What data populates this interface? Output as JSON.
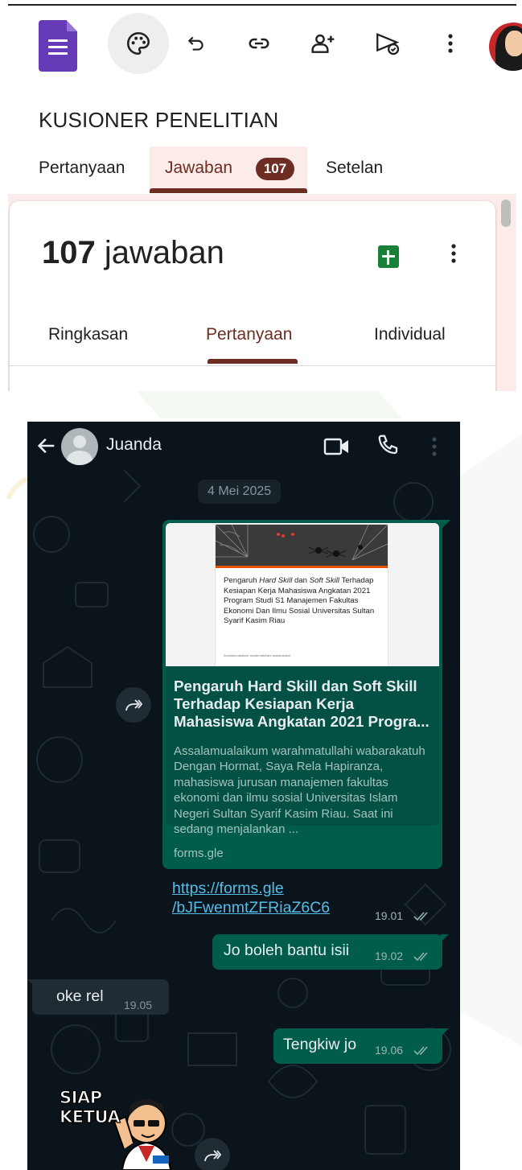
{
  "forms": {
    "toolbar": {
      "logo_icon": "google-forms-icon",
      "icons": [
        "palette-icon",
        "undo-icon",
        "link-icon",
        "add-collaborator-icon",
        "send-icon",
        "more-vert-icon"
      ]
    },
    "title": "KUSIONER PENELITIAN",
    "tabs": [
      {
        "label": "Pertanyaan",
        "active": false
      },
      {
        "label": "Jawaban",
        "active": true,
        "badge": "107"
      },
      {
        "label": "Setelan",
        "active": false
      }
    ],
    "responses": {
      "count": "107",
      "label": "jawaban",
      "sub_tabs": [
        {
          "label": "Ringkasan",
          "active": false
        },
        {
          "label": "Pertanyaan",
          "active": true
        },
        {
          "label": "Individual",
          "active": false
        }
      ]
    },
    "colors": {
      "accent": "#6d2d22",
      "forms_purple": "#673ab7",
      "sheets_green": "#188038"
    }
  },
  "whatsapp": {
    "contact_name": "Juanda",
    "date_chip": "4 Mei 2025",
    "link_preview": {
      "image_text_prefix": "Pengaruh ",
      "image_text_em1": "Hard Skill",
      "image_text_mid": " dan ",
      "image_text_em2": "Soft Skill",
      "image_text_rest": " Terhadap Kesiapan Kerja Mahasiswa Angkatan 2021 Program Studi S1 Manajemen Fakultas Ekonomi Dan Ilmu Sosial Universitas Sultan Syarif Kasim Riau",
      "image_tiny_line": "Assalamualaikum warahmatullahi wabarakatuh",
      "title": "Pengaruh Hard Skill dan Soft Skill Terhadap Kesiapan Kerja Mahasiswa Angkatan 2021 Progra...",
      "description": "Assalamualaikum warahmatullahi wabarakatuh Dengan Hormat, Saya Rela Hapiranza, mahasiswa jurusan manajemen fakultas ekonomi dan ilmu sosial Universitas Islam Negeri Sultan Syarif Kasim Riau. Saat ini sedang menjalankan ...",
      "domain": "forms.gle",
      "url_line1": "https://forms.gle",
      "url_line2": "/bJFwenmtZFRiaZ6C6",
      "time": "19.01"
    },
    "messages": [
      {
        "direction": "out",
        "text": "Jo boleh bantu isii",
        "time": "19.02",
        "status": "read"
      },
      {
        "direction": "in",
        "text": "oke rel",
        "time": "19.05"
      },
      {
        "direction": "out",
        "text": "Tengkiw jo",
        "time": "19.06",
        "status": "read"
      }
    ],
    "sticker": {
      "text_line1": "SIAP",
      "text_line2": "KETUA"
    },
    "colors": {
      "background": "#0b141a",
      "outgoing_bubble": "#005c4b",
      "incoming_bubble": "#202c33",
      "link": "#53bdeb",
      "read_ticks": "#53bdeb"
    }
  }
}
